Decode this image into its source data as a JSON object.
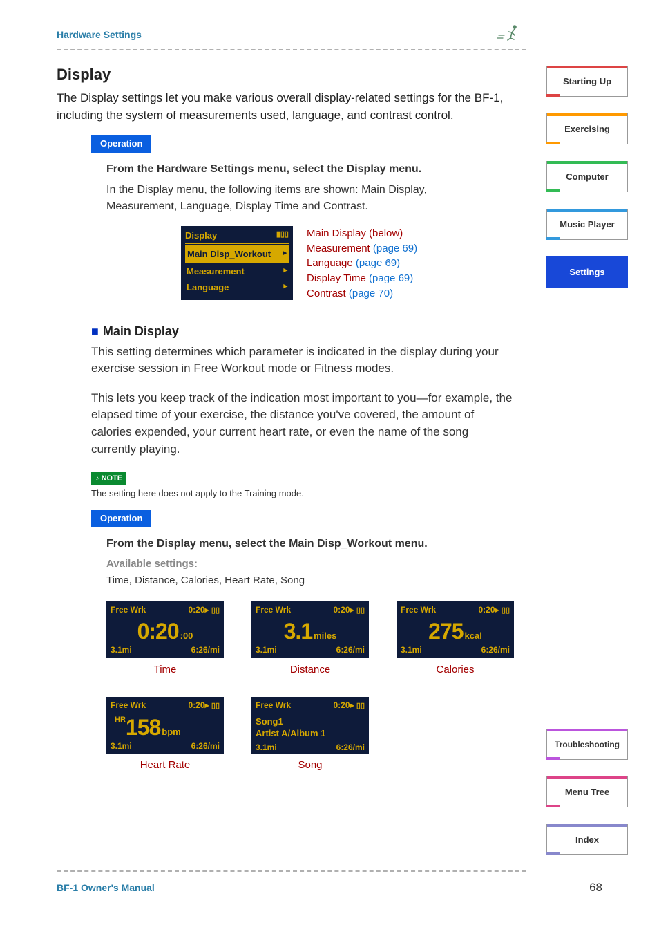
{
  "header": {
    "breadcrumb": "Hardware Settings"
  },
  "title": "Display",
  "intro": "The Display settings let you make various overall display-related settings for the BF-1, including the system of measurements used, language, and contrast control.",
  "operation_label": "Operation",
  "step1": {
    "head": "From the Hardware Settings menu, select the Display menu.",
    "body": "In the Display menu, the following items are shown: Main Display, Measurement, Language, Display Time and Contrast."
  },
  "lcd_menu": {
    "title": "Display",
    "items": [
      "Main Disp_Workout",
      "Measurement",
      "Language"
    ],
    "selected_index": 0
  },
  "links": [
    {
      "label": "Main Display",
      "page": "(below)"
    },
    {
      "label": "Measurement",
      "page": "(page 69)"
    },
    {
      "label": "Language",
      "page": "(page 69)"
    },
    {
      "label": "Display Time",
      "page": "(page 69)"
    },
    {
      "label": "Contrast",
      "page": "(page 70)"
    }
  ],
  "main_display": {
    "heading": "Main Display",
    "p1": "This setting determines which parameter is indicated in the display during your exercise session in Free Workout mode or Fitness modes.",
    "p2": "This lets you keep track of the indication most important to you—for example, the elapsed time of your exercise, the distance you've covered, the amount of calories expended, your current heart rate, or even the name of the song currently playing.",
    "note_label": "NOTE",
    "note": "The setting here does not apply to the Training mode.",
    "step_head": "From the Display menu, select the Main Disp_Workout menu.",
    "avail_head": "Available settings:",
    "avail_body": "Time, Distance, Calories, Heart Rate, Song"
  },
  "screens": {
    "common": {
      "mode": "Free Wrk",
      "timer": "0:20▸",
      "dist": "3.1mi",
      "pace": "6:26/mi"
    },
    "time": {
      "big": "0:20",
      "unit": ":00",
      "caption": "Time"
    },
    "distance": {
      "big": "3.1",
      "unit": "miles",
      "caption": "Distance"
    },
    "calories": {
      "big": "275",
      "unit": "kcal",
      "caption": "Calories"
    },
    "hr": {
      "prefix": "HR",
      "big": "158",
      "unit": "bpm",
      "caption": "Heart Rate"
    },
    "song": {
      "line1": "Song1",
      "line2": "Artist A/Album 1",
      "caption": "Song"
    }
  },
  "tabs_top": [
    {
      "label": "Starting Up",
      "cls": "c1"
    },
    {
      "label": "Exercising",
      "cls": "c2"
    },
    {
      "label": "Computer",
      "cls": "c3"
    },
    {
      "label": "Music Player",
      "cls": "c4"
    },
    {
      "label": "Settings",
      "cls": "c5"
    }
  ],
  "tabs_bottom": [
    {
      "label": "Troubleshooting",
      "cls": "c6"
    },
    {
      "label": "Menu Tree",
      "cls": "c7"
    },
    {
      "label": "Index",
      "cls": "c8"
    }
  ],
  "footer": {
    "manual": "BF-1 Owner's Manual",
    "page": "68"
  }
}
